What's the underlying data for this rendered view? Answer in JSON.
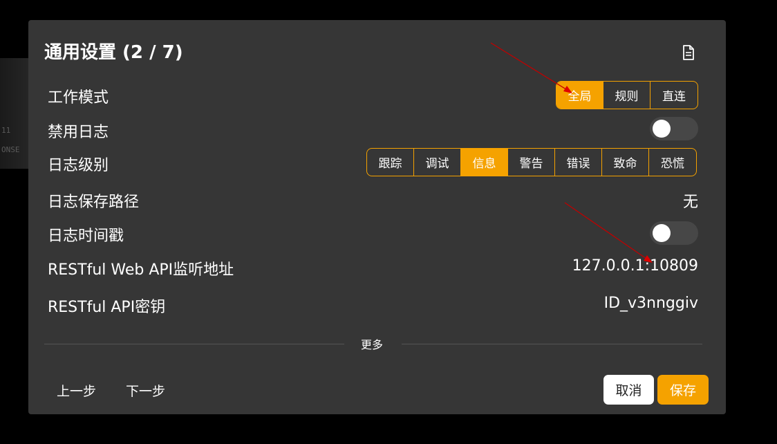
{
  "background": {
    "sliver_texts": [
      "11",
      "ONSE"
    ]
  },
  "dialog": {
    "title": "通用设置 (2 / 7)",
    "doc_icon": "document-icon"
  },
  "rows": {
    "work_mode": {
      "label": "工作模式",
      "options": [
        "全局",
        "规则",
        "直连"
      ],
      "selected": "全局"
    },
    "disable_log": {
      "label": "禁用日志",
      "enabled": false
    },
    "log_level": {
      "label": "日志级别",
      "options": [
        "跟踪",
        "调试",
        "信息",
        "警告",
        "错误",
        "致命",
        "恐慌"
      ],
      "selected": "信息"
    },
    "log_path": {
      "label": "日志保存路径",
      "value": "无"
    },
    "log_timestamp": {
      "label": "日志时间戳",
      "enabled": false
    },
    "api_listen": {
      "label": "RESTful Web API监听地址",
      "value": "127.0.0.1:10809"
    },
    "api_key": {
      "label": "RESTful API密钥",
      "value": "ID_v3nnggiv"
    }
  },
  "more_label": "更多",
  "footer": {
    "prev": "上一步",
    "next": "下一步",
    "cancel": "取消",
    "save": "保存"
  },
  "colors": {
    "accent": "#f5a200",
    "dialog_bg": "#363636",
    "annotation_arrow": "#c00000"
  }
}
